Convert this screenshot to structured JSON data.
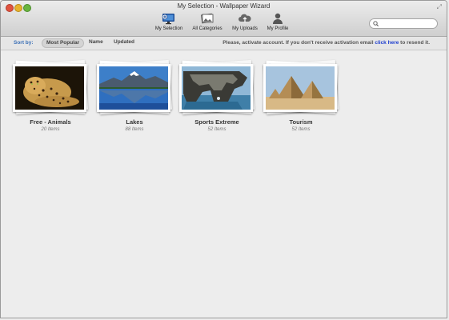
{
  "window": {
    "title": "My Selection - Wallpaper Wizard"
  },
  "toolbar": {
    "items": [
      {
        "label": "My Selection",
        "icon": "monitor-plus-icon"
      },
      {
        "label": "All Categories",
        "icon": "photos-stack-icon"
      },
      {
        "label": "My Uploads",
        "icon": "cloud-upload-icon"
      },
      {
        "label": "My Profile",
        "icon": "person-icon"
      }
    ]
  },
  "search": {
    "placeholder": "",
    "value": ""
  },
  "sort": {
    "label": "Sort by:",
    "options": [
      "Most Popular",
      "Name",
      "Updated"
    ],
    "selected": "Most Popular"
  },
  "notice": {
    "text": "Please, activate account. If you don't receive activation email",
    "link": "click here",
    "suffix": "to resend it."
  },
  "categories": [
    {
      "title": "Free - Animals",
      "count": "20 Items",
      "image": "leopard"
    },
    {
      "title": "Lakes",
      "count": "88 Items",
      "image": "mountain-lake"
    },
    {
      "title": "Sports Extreme",
      "count": "52 Items",
      "image": "cliff-sea"
    },
    {
      "title": "Tourism",
      "count": "52 Items",
      "image": "pyramids"
    }
  ],
  "colors": {
    "accent": "#3a6fb6",
    "link": "#1f3fcf",
    "background": "#ededed"
  }
}
